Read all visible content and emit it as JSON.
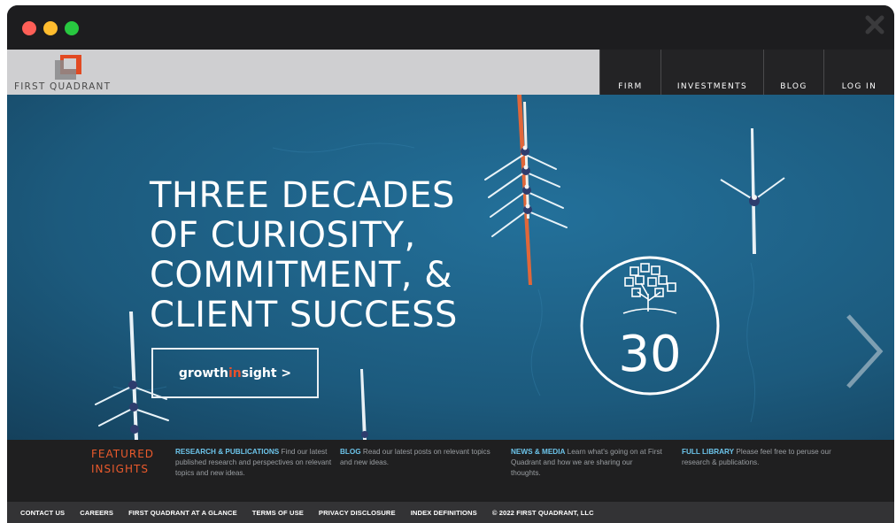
{
  "window": {
    "controls": [
      "close",
      "minimize",
      "zoom"
    ],
    "close_icon": "close-x-icon"
  },
  "header": {
    "logo_text": "FIRST QUADRANT",
    "logo_icon": "first-quadrant-logo-mark",
    "nav": [
      {
        "label": "FIRM"
      },
      {
        "label": "INVESTMENTS"
      },
      {
        "label": "BLOG"
      },
      {
        "label": "LOG IN"
      }
    ]
  },
  "hero": {
    "headline": [
      "THREE DECADES",
      "OF CURIOSITY,",
      "COMMITMENT, &",
      "CLIENT SUCCESS"
    ],
    "cta": {
      "part1": "growth",
      "part2": "in",
      "part3": "sight",
      "arrow": " >"
    },
    "badge_number": "30",
    "badge_icon": "tree-icon",
    "next_icon": "chevron-right-icon",
    "accent_color": "#e8502b",
    "water_color": "#1d5b7e"
  },
  "insights": {
    "heading": [
      "FEATURED",
      "INSIGHTS"
    ],
    "items": [
      {
        "title": "RESEARCH & PUBLICATIONS",
        "text": " Find our latest published research and perspectives on relevant topics and new ideas."
      },
      {
        "title": "BLOG",
        "text": " Read our latest posts on relevant topics and new ideas."
      },
      {
        "title": "NEWS & MEDIA",
        "text": " Learn what's going on at First Quadrant and how we are sharing our thoughts."
      },
      {
        "title": "FULL LIBRARY",
        "text": " Please feel free to peruse our research & publications."
      }
    ],
    "title_color": "#6cc4ea",
    "heading_color": "#ea5a2c"
  },
  "footer": {
    "links": [
      "CONTACT US",
      "CAREERS",
      "FIRST QUADRANT AT A GLANCE",
      "TERMS OF USE",
      "PRIVACY DISCLOSURE",
      "INDEX DEFINITIONS"
    ],
    "copyright": "© 2022 FIRST QUADRANT, LLC"
  }
}
